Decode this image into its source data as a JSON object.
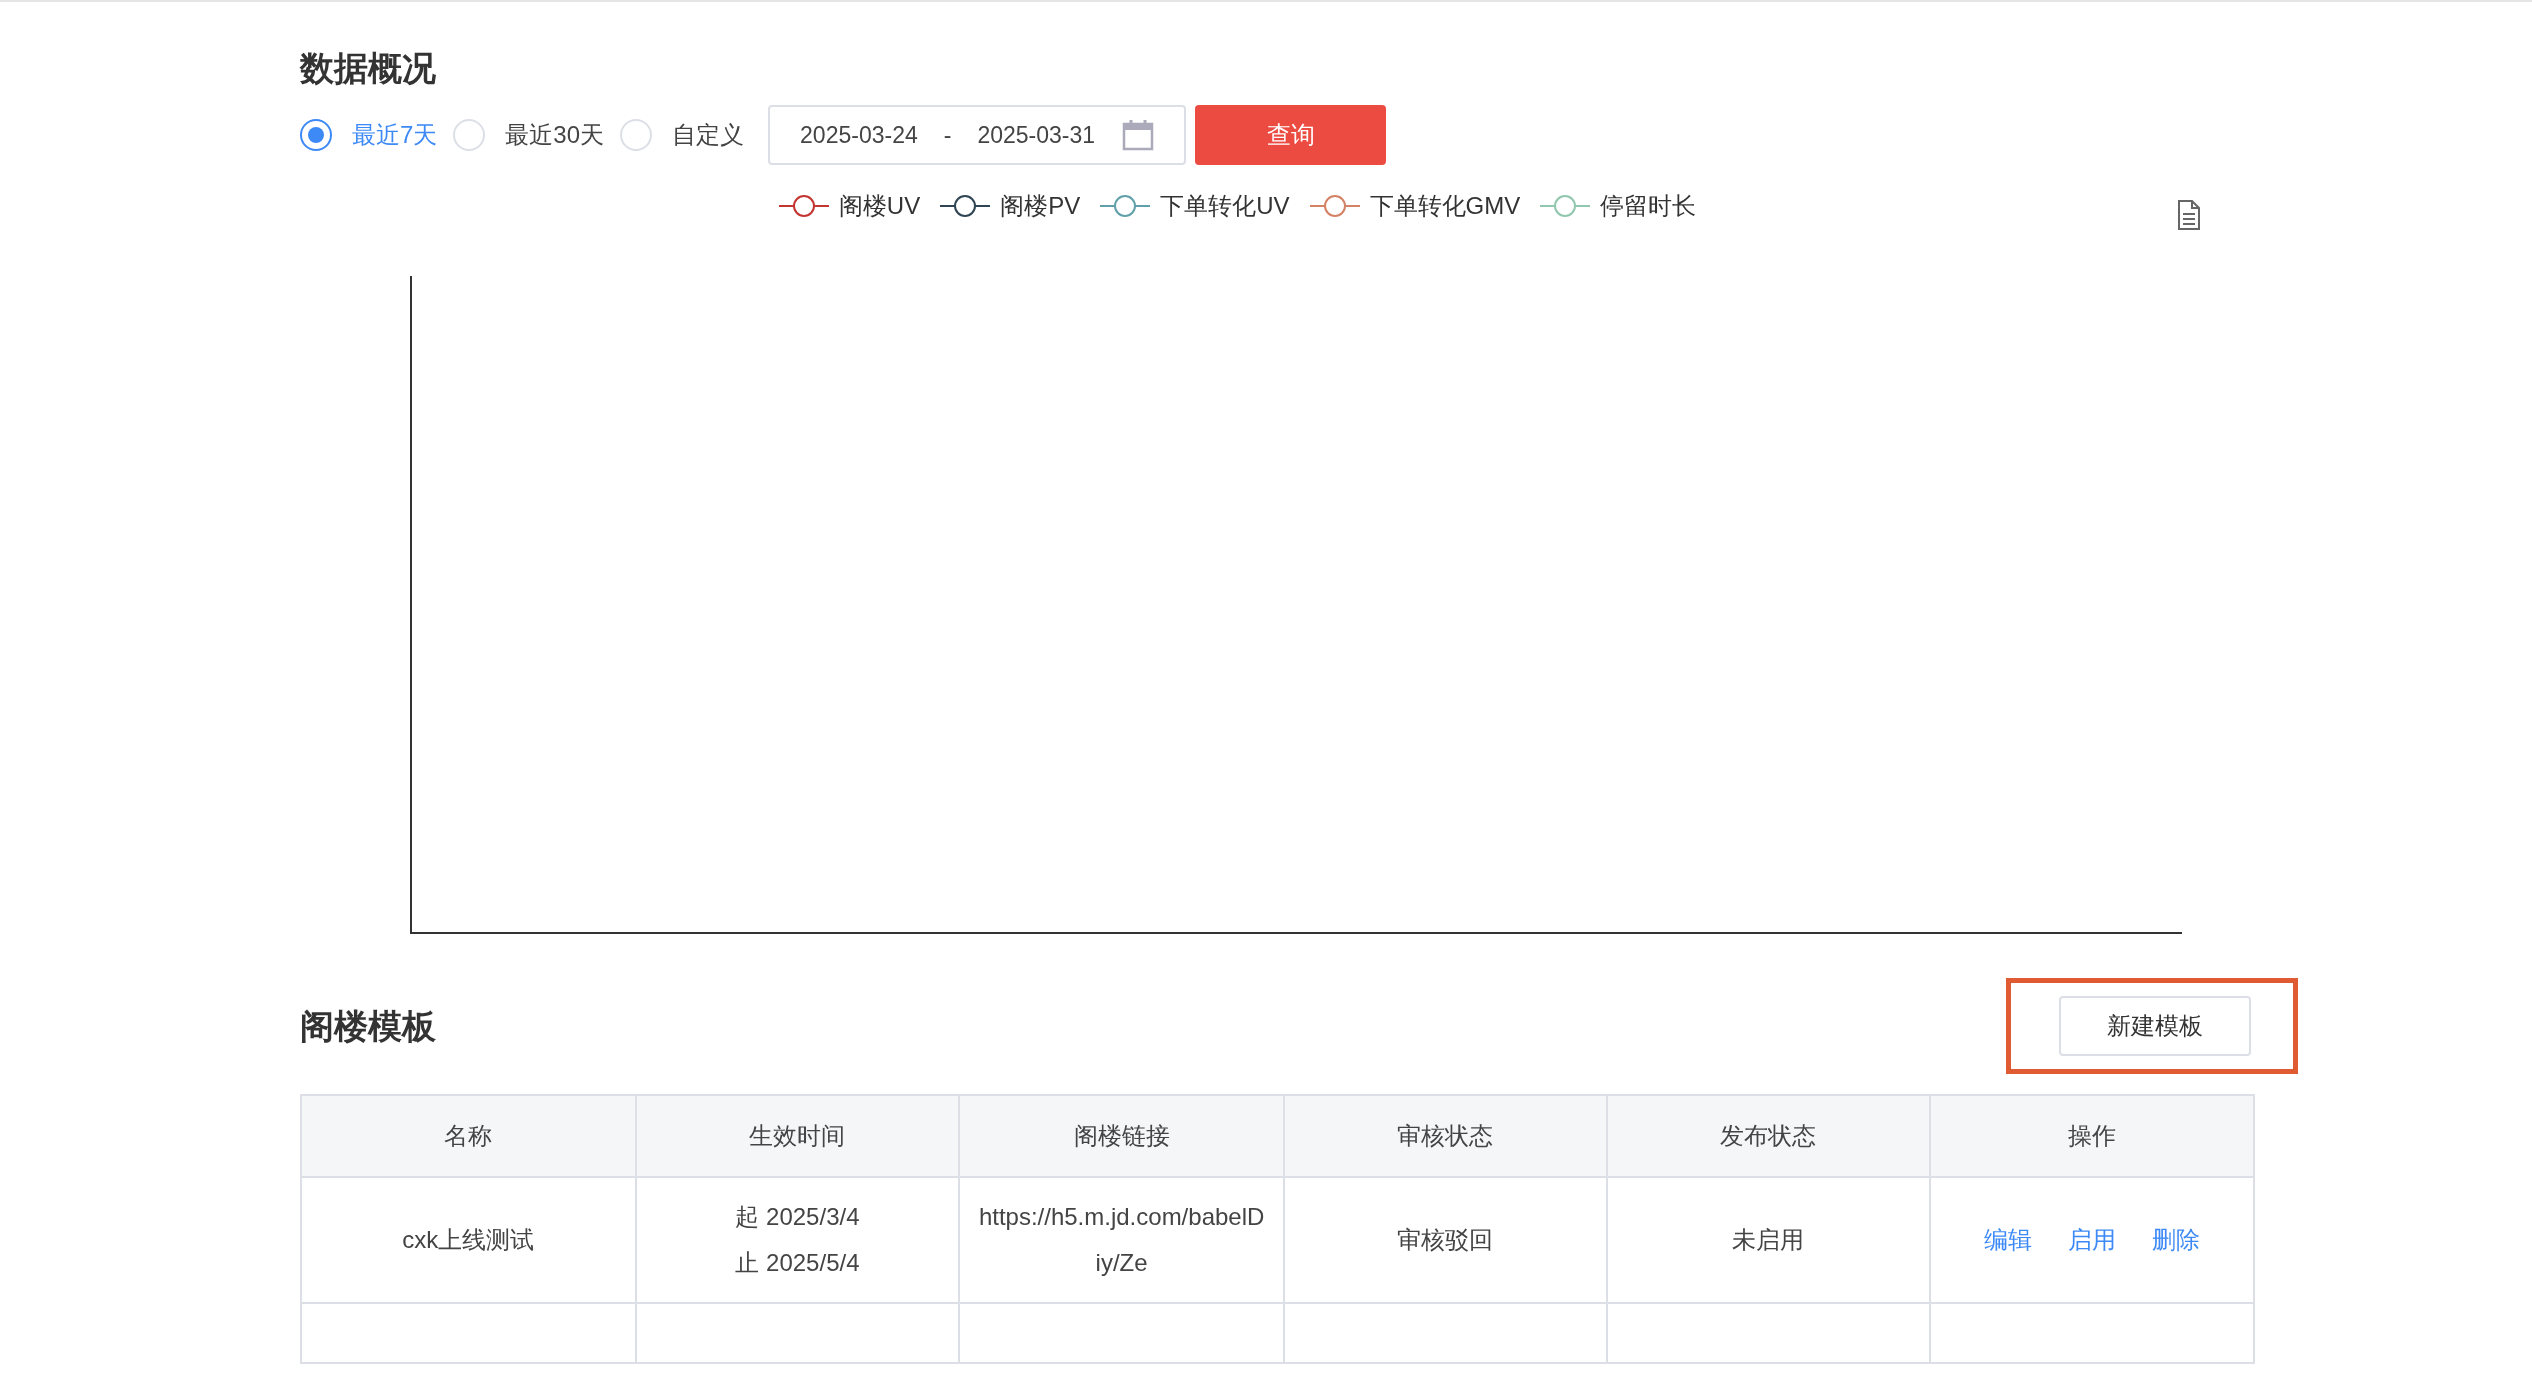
{
  "overview": {
    "title": "数据概况",
    "ranges": [
      {
        "label": "最近7天",
        "selected": true
      },
      {
        "label": "最近30天",
        "selected": false
      },
      {
        "label": "自定义",
        "selected": false
      }
    ],
    "date_start": "2025-03-24",
    "date_separator": "-",
    "date_end": "2025-03-31",
    "query_button": "查询",
    "legend": [
      {
        "label": "阁楼UV",
        "color": "#c23531"
      },
      {
        "label": "阁楼PV",
        "color": "#2f4554"
      },
      {
        "label": "下单转化UV",
        "color": "#61a0a8"
      },
      {
        "label": "下单转化GMV",
        "color": "#d48265"
      },
      {
        "label": "停留时长",
        "color": "#91c7ae"
      }
    ]
  },
  "templates": {
    "title": "阁楼模板",
    "new_button": "新建模板",
    "new_button_highlighted": true,
    "columns": [
      "名称",
      "生效时间",
      "阁楼链接",
      "审核状态",
      "发布状态",
      "操作"
    ],
    "rows": [
      {
        "name": "cxk上线测试",
        "start": "起 2025/3/4",
        "end": "止 2025/5/4",
        "link": "https://h5.m.jd.com/babelDiy/Ze",
        "review": "审核驳回",
        "publish": "未启用",
        "actions": [
          "编辑",
          "启用",
          "删除"
        ]
      }
    ]
  }
}
